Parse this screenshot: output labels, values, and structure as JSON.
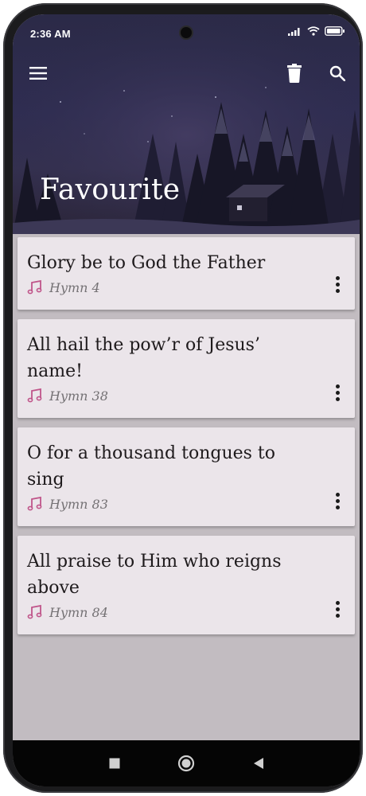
{
  "status": {
    "time": "2:36 AM"
  },
  "toolbar": {
    "menu_icon": "menu-icon",
    "delete_icon": "trash-icon",
    "search_icon": "search-icon",
    "title": "Favourite"
  },
  "hymns": [
    {
      "title": "Glory be to God the Father",
      "number": "Hymn 4"
    },
    {
      "title": "All hail the pow’r of Jesus’ name!",
      "number": "Hymn 38"
    },
    {
      "title": "O for a thousand tongues to sing",
      "number": "Hymn 83"
    },
    {
      "title": "All praise to Him who reigns above",
      "number": "Hymn 84"
    }
  ],
  "nav": {
    "recent": "square-icon",
    "home": "circle-icon",
    "back": "triangle-icon"
  },
  "colors": {
    "accent": "#c0558a",
    "card": "#ebe5ea",
    "background": "#c2bcc1"
  }
}
